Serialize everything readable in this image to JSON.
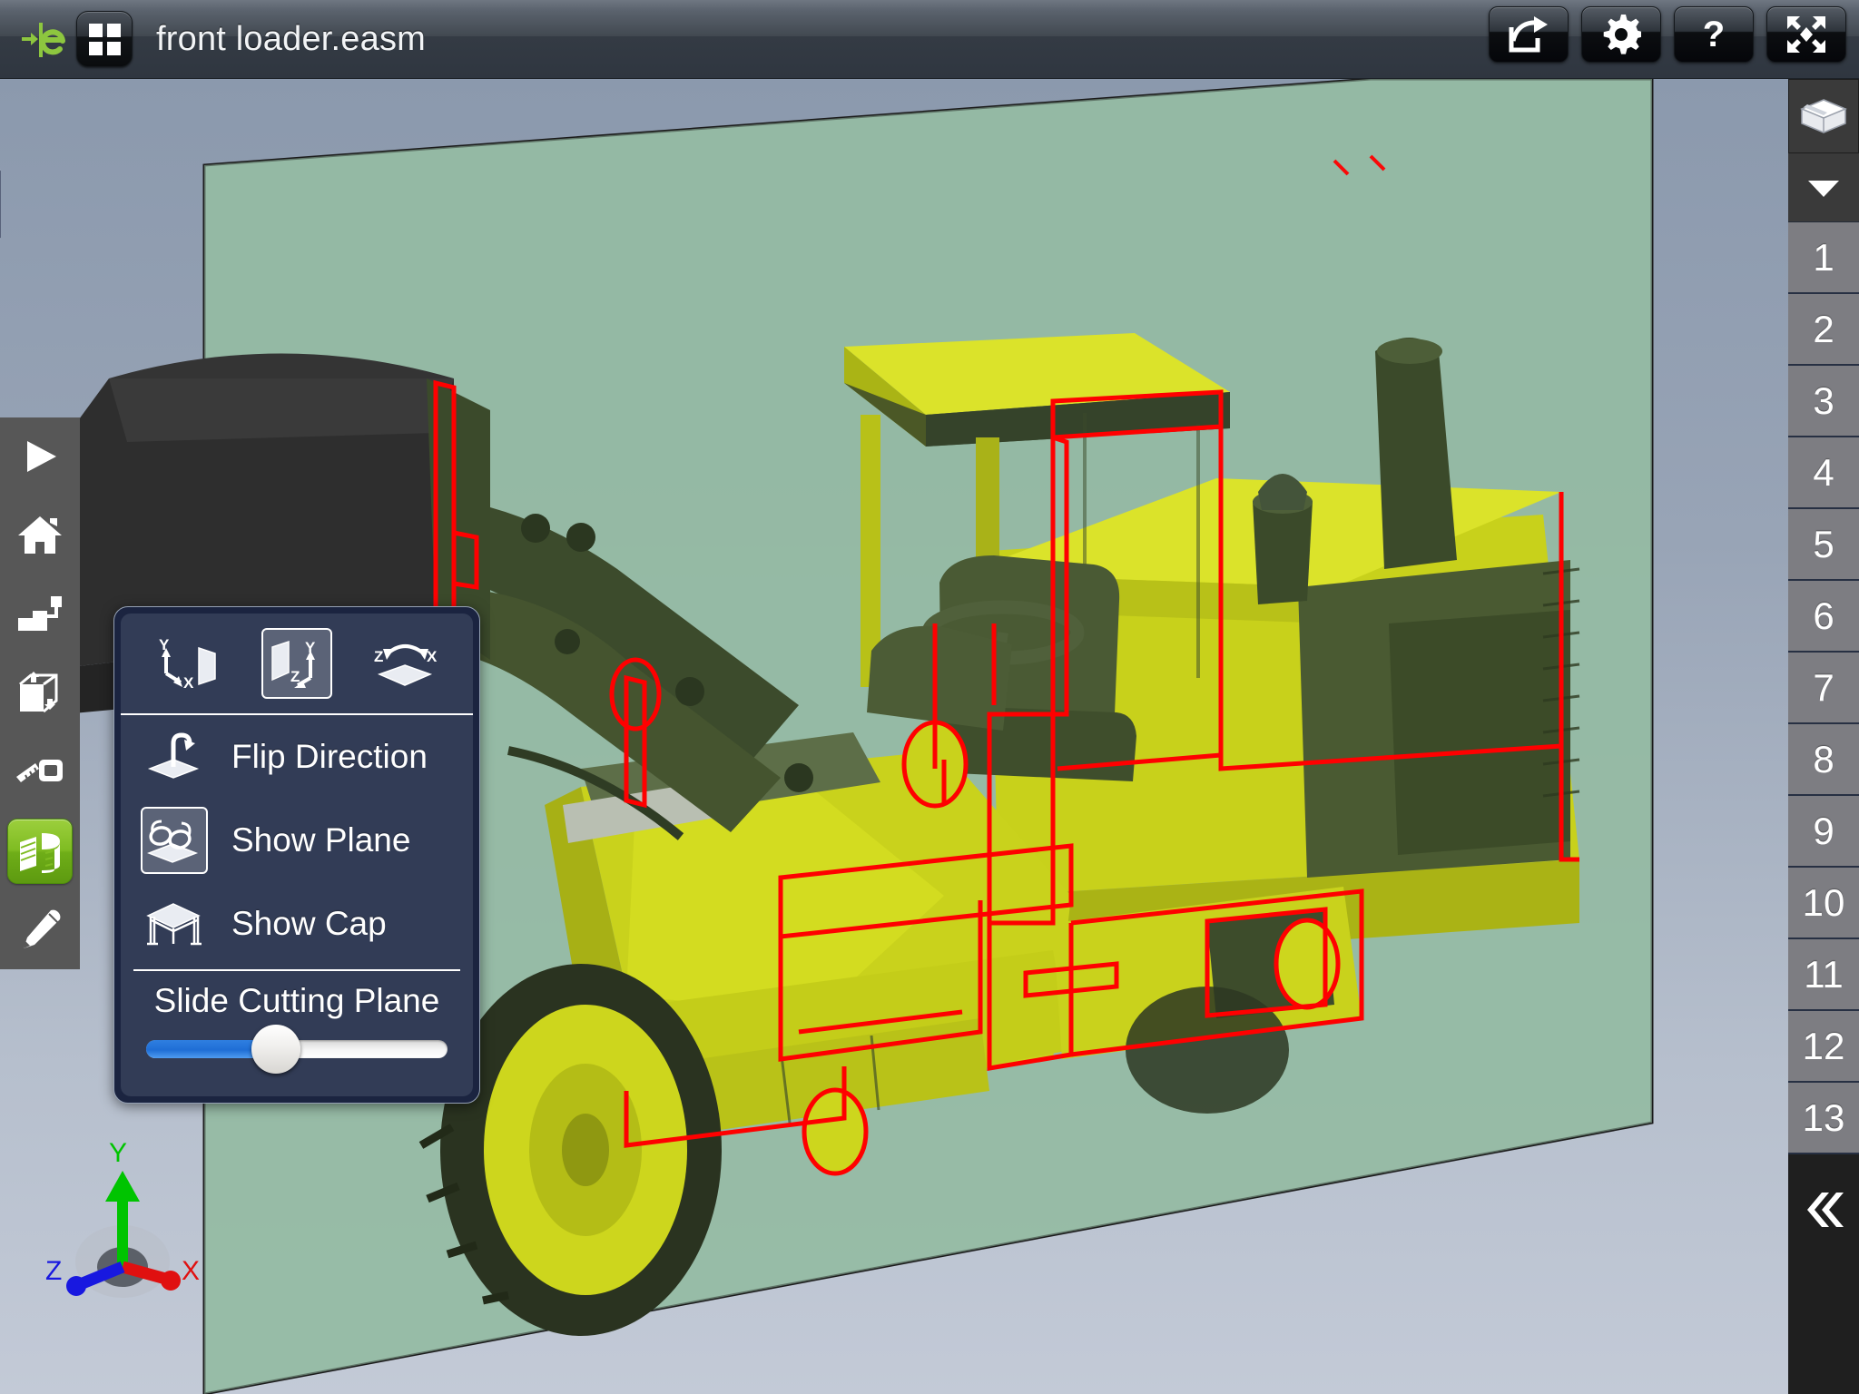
{
  "app": {
    "logo_icon": "eDrawings-e-logo",
    "grid_icon": "grid-menu-icon",
    "document_title": "front loader.easm"
  },
  "header_actions": [
    {
      "name": "share-button",
      "icon": "share-arrow-icon"
    },
    {
      "name": "settings-button",
      "icon": "gear-icon"
    },
    {
      "name": "help-button",
      "icon": "question-mark-icon",
      "glyph": "?"
    },
    {
      "name": "fullscreen-button",
      "icon": "fullscreen-arrows-icon"
    }
  ],
  "left_toolbar": {
    "items": [
      {
        "name": "play-animation-tool",
        "icon": "play-icon",
        "active": false
      },
      {
        "name": "home-view-tool",
        "icon": "home-icon",
        "active": false
      },
      {
        "name": "explode-tool",
        "icon": "explode-icon",
        "active": false
      },
      {
        "name": "cross-section-box-tool",
        "icon": "box-arrow-icon",
        "active": false
      },
      {
        "name": "measure-tool",
        "icon": "tape-measure-icon",
        "active": false
      },
      {
        "name": "section-view-tool",
        "icon": "cut-section-icon",
        "active": true
      },
      {
        "name": "markup-tool",
        "icon": "pencil-icon",
        "active": false
      }
    ],
    "active_color": "#7fbc22"
  },
  "section_popup": {
    "plane_options": [
      {
        "name": "plane-yx-button",
        "icon": "plane-yx-icon",
        "labels": [
          "Y",
          "X"
        ],
        "selected": false
      },
      {
        "name": "plane-yz-button",
        "icon": "plane-yz-icon",
        "labels": [
          "Y",
          "Z"
        ],
        "selected": true
      },
      {
        "name": "plane-zx-button",
        "icon": "plane-zx-icon",
        "labels": [
          "Z",
          "X"
        ],
        "selected": false
      }
    ],
    "menu_items": [
      {
        "name": "flip-direction-item",
        "icon": "flip-direction-icon",
        "label": "Flip Direction",
        "selected": false
      },
      {
        "name": "show-plane-item",
        "icon": "glasses-plane-icon",
        "label": "Show Plane",
        "selected": true
      },
      {
        "name": "show-cap-item",
        "icon": "cap-table-icon",
        "label": "Show Cap",
        "selected": false
      }
    ],
    "slider": {
      "label": "Slide Cutting Plane",
      "value_percent": 43,
      "fill_color": "#2f7fe0"
    }
  },
  "right_panel": {
    "parts_icon": "stacked-parts-icon",
    "expand_icon": "chevron-down-icon",
    "collapse_icon": "double-chevron-left-icon",
    "configuration_numbers": [
      "1",
      "2",
      "3",
      "4",
      "5",
      "6",
      "7",
      "8",
      "9",
      "10",
      "11",
      "12",
      "13"
    ]
  },
  "axis_triad": {
    "x_label": "X",
    "y_label": "Y",
    "z_label": "Z",
    "x_color": "#e01010",
    "y_color": "#00c400",
    "z_color": "#1818e0"
  },
  "model": {
    "name": "front-loader-3d-model",
    "body_color": "#d2da1e",
    "shadow_color": "#3b4a2b",
    "section_edge_color": "#ff0000",
    "cutting_plane_color": "#91b7a0",
    "background_top": "#8b99ad",
    "background_bottom": "#c2c9d6"
  }
}
